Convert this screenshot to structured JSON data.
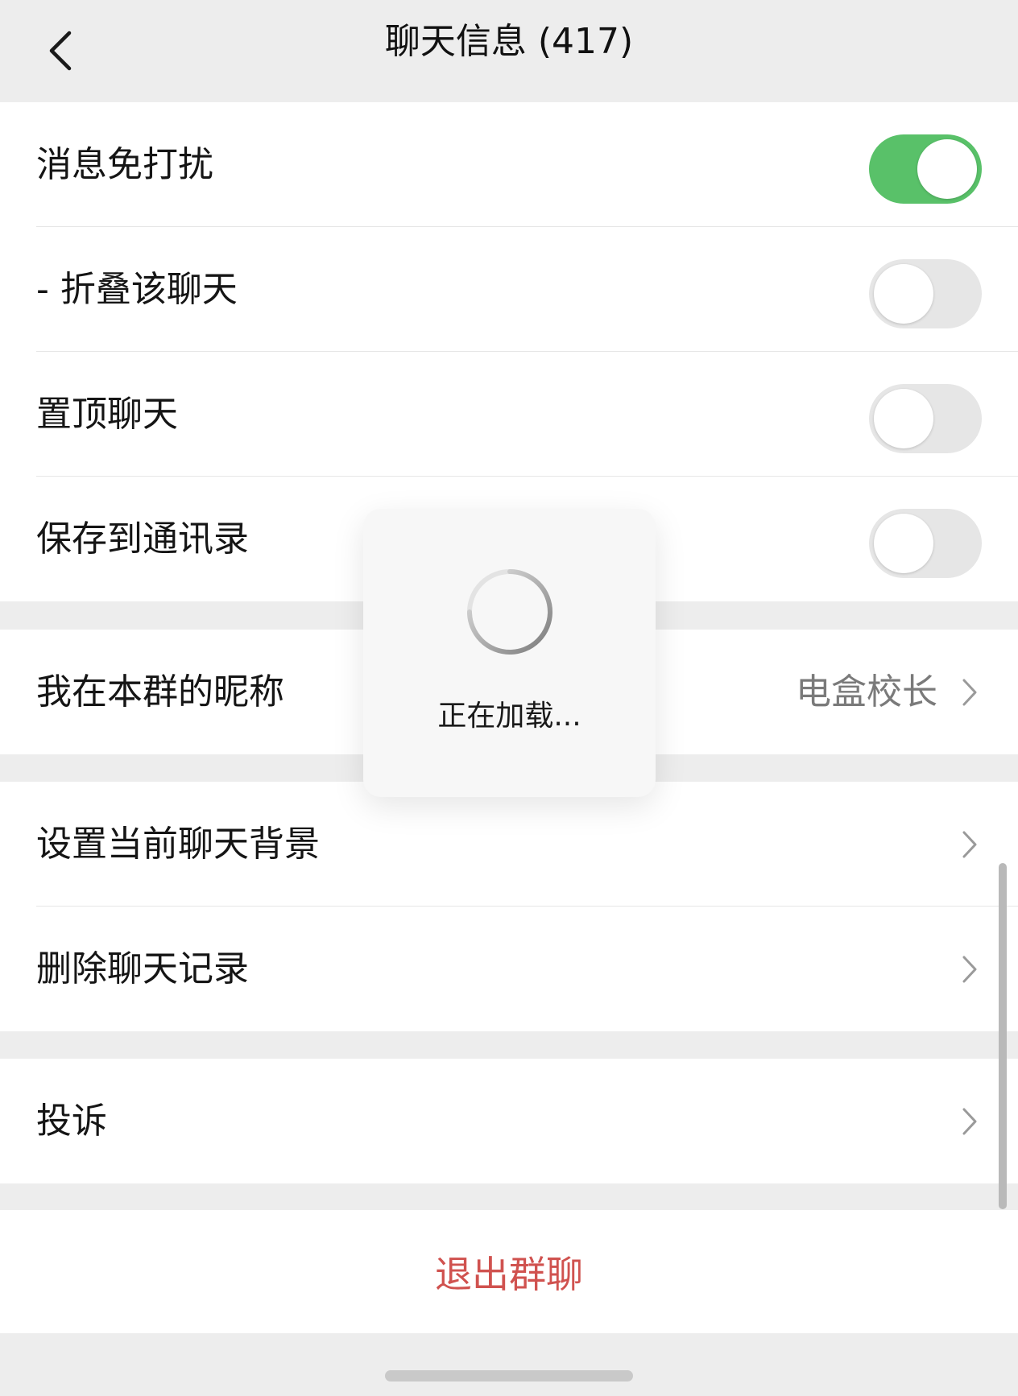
{
  "header": {
    "title": "聊天信息 (417)",
    "back_icon": "chevron-left-icon"
  },
  "group1": {
    "rows": [
      {
        "label": "消息免打扰",
        "toggle_on": true
      },
      {
        "label": "- 折叠该聊天",
        "toggle_on": false
      },
      {
        "label": "置顶聊天",
        "toggle_on": false
      },
      {
        "label": "保存到通讯录",
        "toggle_on": false
      }
    ]
  },
  "group2": {
    "rows": [
      {
        "label": "我在本群的昵称",
        "value": "电盒校长"
      }
    ]
  },
  "group3": {
    "rows": [
      {
        "label": "设置当前聊天背景"
      },
      {
        "label": "删除聊天记录"
      }
    ]
  },
  "group4": {
    "rows": [
      {
        "label": "投诉"
      }
    ]
  },
  "exit": {
    "label": "退出群聊"
  },
  "loading": {
    "text": "正在加载..."
  },
  "colors": {
    "toggle_on": "#59c169",
    "toggle_off": "#e6e6e6",
    "danger": "#d0524f",
    "background": "#ededed"
  }
}
